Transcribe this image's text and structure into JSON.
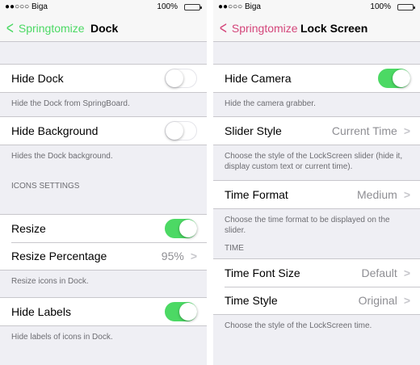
{
  "colors": {
    "accent_left": "#4cd964",
    "accent_right": "#d4467a",
    "toggle_on": "#4cd964"
  },
  "left": {
    "status": {
      "carrier": "●●○○○ Biga",
      "battery": "100%"
    },
    "nav": {
      "back_label": "Springtomize",
      "title": "Dock"
    },
    "hide_dock": {
      "label": "Hide Dock",
      "on": false,
      "footer": "Hide the Dock from SpringBoard."
    },
    "hide_background": {
      "label": "Hide Background",
      "on": false,
      "footer": "Hides the Dock background."
    },
    "icons_settings_header": "ICONS SETTINGS",
    "resize": {
      "label": "Resize",
      "on": true
    },
    "resize_percentage": {
      "label": "Resize Percentage",
      "value": "95%"
    },
    "resize_footer": "Resize icons in Dock.",
    "hide_labels": {
      "label": "Hide Labels",
      "on": true,
      "footer": "Hide labels of icons in Dock."
    }
  },
  "right": {
    "status": {
      "carrier": "●●○○○ Biga",
      "battery": "100%"
    },
    "nav": {
      "back_label": "Springtomize",
      "title": "Lock Screen"
    },
    "hide_camera": {
      "label": "Hide Camera",
      "on": true,
      "footer": "Hide the camera grabber."
    },
    "slider_style": {
      "label": "Slider Style",
      "value": "Current Time",
      "footer": "Choose the style of the LockScreen slider (hide it, display custom text or current time)."
    },
    "time_format": {
      "label": "Time Format",
      "value": "Medium",
      "footer": "Choose the time format to be displayed on the slider."
    },
    "time_header": "TIME",
    "time_font_size": {
      "label": "Time Font Size",
      "value": "Default"
    },
    "time_style": {
      "label": "Time Style",
      "value": "Original"
    },
    "time_footer": "Choose the style of the LockScreen time."
  }
}
